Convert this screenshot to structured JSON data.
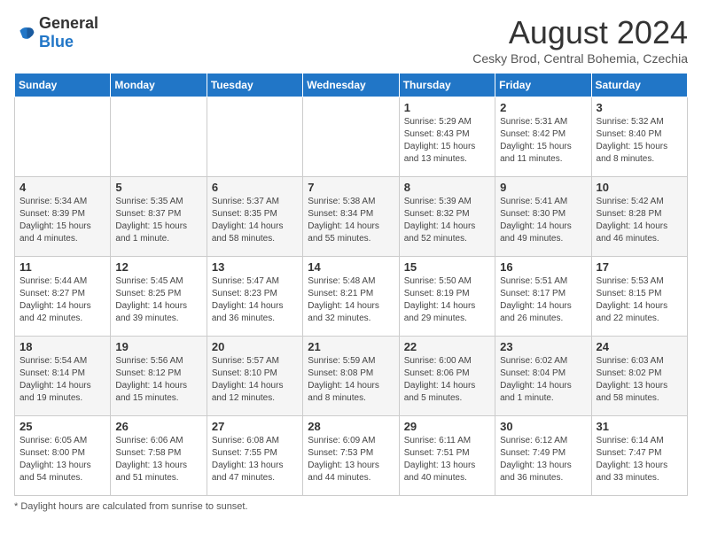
{
  "header": {
    "logo_general": "General",
    "logo_blue": "Blue",
    "month_year": "August 2024",
    "location": "Cesky Brod, Central Bohemia, Czechia"
  },
  "days_of_week": [
    "Sunday",
    "Monday",
    "Tuesday",
    "Wednesday",
    "Thursday",
    "Friday",
    "Saturday"
  ],
  "weeks": [
    [
      {
        "day": "",
        "info": ""
      },
      {
        "day": "",
        "info": ""
      },
      {
        "day": "",
        "info": ""
      },
      {
        "day": "",
        "info": ""
      },
      {
        "day": "1",
        "info": "Sunrise: 5:29 AM\nSunset: 8:43 PM\nDaylight: 15 hours\nand 13 minutes."
      },
      {
        "day": "2",
        "info": "Sunrise: 5:31 AM\nSunset: 8:42 PM\nDaylight: 15 hours\nand 11 minutes."
      },
      {
        "day": "3",
        "info": "Sunrise: 5:32 AM\nSunset: 8:40 PM\nDaylight: 15 hours\nand 8 minutes."
      }
    ],
    [
      {
        "day": "4",
        "info": "Sunrise: 5:34 AM\nSunset: 8:39 PM\nDaylight: 15 hours\nand 4 minutes."
      },
      {
        "day": "5",
        "info": "Sunrise: 5:35 AM\nSunset: 8:37 PM\nDaylight: 15 hours\nand 1 minute."
      },
      {
        "day": "6",
        "info": "Sunrise: 5:37 AM\nSunset: 8:35 PM\nDaylight: 14 hours\nand 58 minutes."
      },
      {
        "day": "7",
        "info": "Sunrise: 5:38 AM\nSunset: 8:34 PM\nDaylight: 14 hours\nand 55 minutes."
      },
      {
        "day": "8",
        "info": "Sunrise: 5:39 AM\nSunset: 8:32 PM\nDaylight: 14 hours\nand 52 minutes."
      },
      {
        "day": "9",
        "info": "Sunrise: 5:41 AM\nSunset: 8:30 PM\nDaylight: 14 hours\nand 49 minutes."
      },
      {
        "day": "10",
        "info": "Sunrise: 5:42 AM\nSunset: 8:28 PM\nDaylight: 14 hours\nand 46 minutes."
      }
    ],
    [
      {
        "day": "11",
        "info": "Sunrise: 5:44 AM\nSunset: 8:27 PM\nDaylight: 14 hours\nand 42 minutes."
      },
      {
        "day": "12",
        "info": "Sunrise: 5:45 AM\nSunset: 8:25 PM\nDaylight: 14 hours\nand 39 minutes."
      },
      {
        "day": "13",
        "info": "Sunrise: 5:47 AM\nSunset: 8:23 PM\nDaylight: 14 hours\nand 36 minutes."
      },
      {
        "day": "14",
        "info": "Sunrise: 5:48 AM\nSunset: 8:21 PM\nDaylight: 14 hours\nand 32 minutes."
      },
      {
        "day": "15",
        "info": "Sunrise: 5:50 AM\nSunset: 8:19 PM\nDaylight: 14 hours\nand 29 minutes."
      },
      {
        "day": "16",
        "info": "Sunrise: 5:51 AM\nSunset: 8:17 PM\nDaylight: 14 hours\nand 26 minutes."
      },
      {
        "day": "17",
        "info": "Sunrise: 5:53 AM\nSunset: 8:15 PM\nDaylight: 14 hours\nand 22 minutes."
      }
    ],
    [
      {
        "day": "18",
        "info": "Sunrise: 5:54 AM\nSunset: 8:14 PM\nDaylight: 14 hours\nand 19 minutes."
      },
      {
        "day": "19",
        "info": "Sunrise: 5:56 AM\nSunset: 8:12 PM\nDaylight: 14 hours\nand 15 minutes."
      },
      {
        "day": "20",
        "info": "Sunrise: 5:57 AM\nSunset: 8:10 PM\nDaylight: 14 hours\nand 12 minutes."
      },
      {
        "day": "21",
        "info": "Sunrise: 5:59 AM\nSunset: 8:08 PM\nDaylight: 14 hours\nand 8 minutes."
      },
      {
        "day": "22",
        "info": "Sunrise: 6:00 AM\nSunset: 8:06 PM\nDaylight: 14 hours\nand 5 minutes."
      },
      {
        "day": "23",
        "info": "Sunrise: 6:02 AM\nSunset: 8:04 PM\nDaylight: 14 hours\nand 1 minute."
      },
      {
        "day": "24",
        "info": "Sunrise: 6:03 AM\nSunset: 8:02 PM\nDaylight: 13 hours\nand 58 minutes."
      }
    ],
    [
      {
        "day": "25",
        "info": "Sunrise: 6:05 AM\nSunset: 8:00 PM\nDaylight: 13 hours\nand 54 minutes."
      },
      {
        "day": "26",
        "info": "Sunrise: 6:06 AM\nSunset: 7:58 PM\nDaylight: 13 hours\nand 51 minutes."
      },
      {
        "day": "27",
        "info": "Sunrise: 6:08 AM\nSunset: 7:55 PM\nDaylight: 13 hours\nand 47 minutes."
      },
      {
        "day": "28",
        "info": "Sunrise: 6:09 AM\nSunset: 7:53 PM\nDaylight: 13 hours\nand 44 minutes."
      },
      {
        "day": "29",
        "info": "Sunrise: 6:11 AM\nSunset: 7:51 PM\nDaylight: 13 hours\nand 40 minutes."
      },
      {
        "day": "30",
        "info": "Sunrise: 6:12 AM\nSunset: 7:49 PM\nDaylight: 13 hours\nand 36 minutes."
      },
      {
        "day": "31",
        "info": "Sunrise: 6:14 AM\nSunset: 7:47 PM\nDaylight: 13 hours\nand 33 minutes."
      }
    ]
  ],
  "footer": {
    "note": "Daylight hours"
  }
}
